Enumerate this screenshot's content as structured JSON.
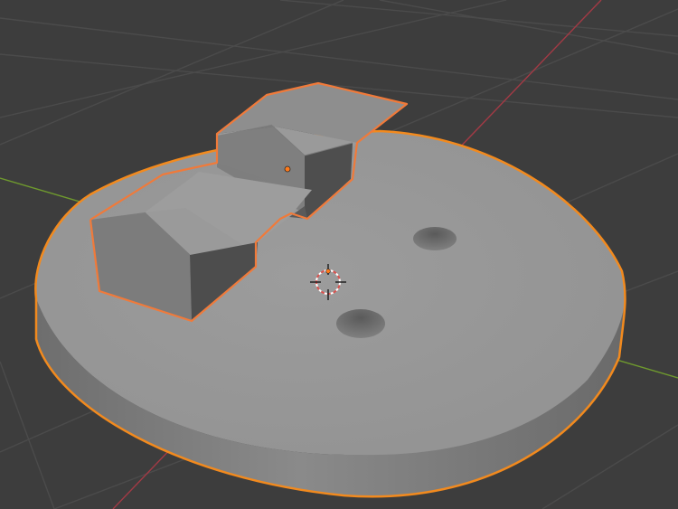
{
  "viewport": {
    "editor": "3D Viewport",
    "background_color": "#3d3d3d",
    "grid_color": "#4a4a4a",
    "x_axis_color": "#a33a45",
    "y_axis_color": "#6f9a2e"
  },
  "scene": {
    "selection_outline_color": "#f28a1e",
    "active_outline_color": "#f07a3a",
    "mesh_top_color": "#999999",
    "mesh_side_color": "#777777",
    "objects": [
      {
        "name": "disc",
        "shape": "cylinder",
        "holes": 2,
        "selected": true
      },
      {
        "name": "bracket",
        "shape": "stepped block",
        "selected": true,
        "active": true
      }
    ],
    "cursor": "3d-cursor"
  }
}
